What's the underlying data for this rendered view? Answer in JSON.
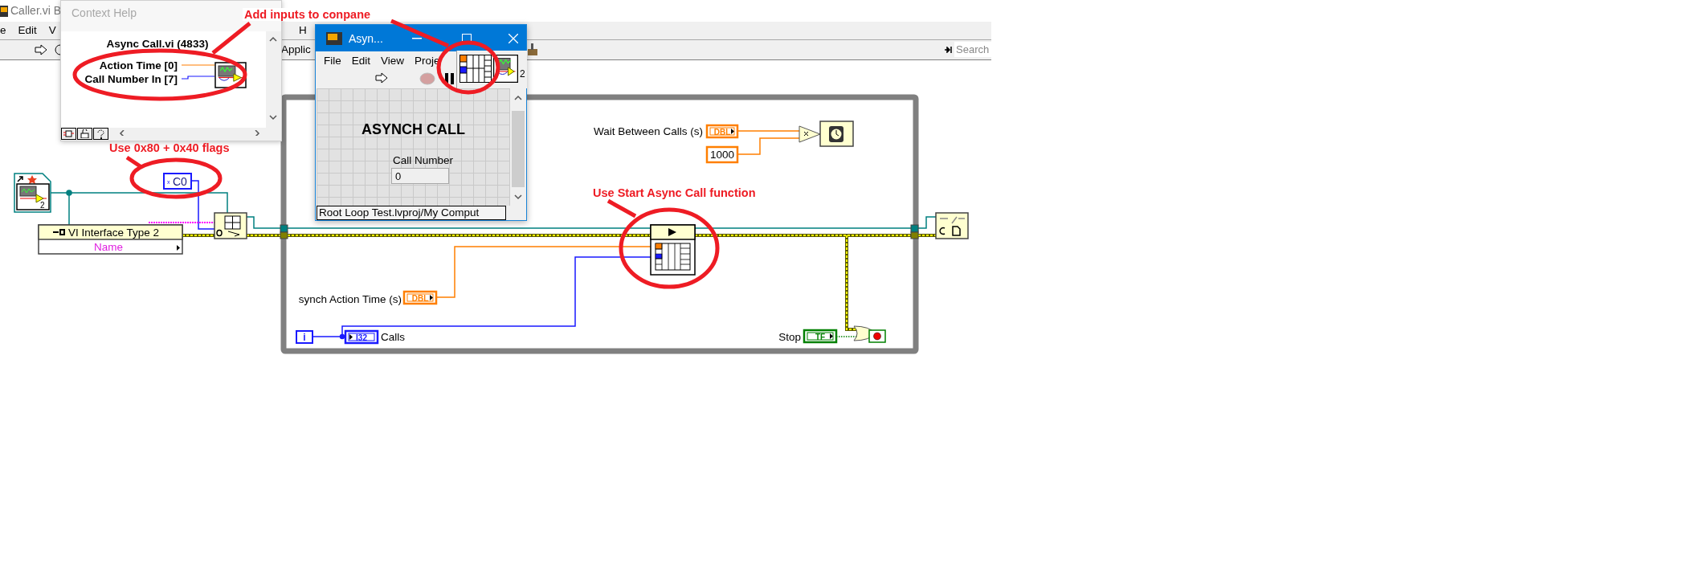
{
  "main_window": {
    "title": "Caller.vi B",
    "menu": [
      "e",
      "Edit",
      "V",
      "H"
    ],
    "toolbar_label": "Applic",
    "search": {
      "placeholder": "Search"
    }
  },
  "context_help": {
    "title": "Context Help",
    "vi_name": "Async Call.vi (4833)",
    "terminals": [
      {
        "label": "Action Time [0]",
        "kind": "numeric"
      },
      {
        "label": "Call Number In [7]",
        "kind": "integer"
      }
    ]
  },
  "front_panel": {
    "title": "Asyn...",
    "menu": [
      "File",
      "Edit",
      "View",
      "Proje"
    ],
    "icon_number": "2",
    "heading": "ASYNCH CALL",
    "control": {
      "label": "Call Number",
      "value": "0"
    },
    "status": "Root Loop Test.lvproj/My Comput"
  },
  "diagram": {
    "vi_reference": {
      "icon_number": "2"
    },
    "flags_constant": {
      "radix": "x",
      "value": "C0"
    },
    "property_node": {
      "class": "VI Interface Type 2",
      "property": "Name"
    },
    "controls": [
      {
        "label": "Wait Between Calls (s)",
        "type": "DBL"
      },
      {
        "label": "synch Action Time (s)",
        "type": "DBL"
      }
    ],
    "numeric_constant": "1000",
    "iteration_terminal": "i",
    "calls_indicator": {
      "label": "Calls",
      "type": "I32"
    },
    "stop_control": {
      "label": "Stop",
      "type": "TF"
    }
  },
  "annotations": [
    "Add inputs to conpane",
    "Use 0x80 + 0x40 flags",
    "Use Start Async Call function"
  ]
}
